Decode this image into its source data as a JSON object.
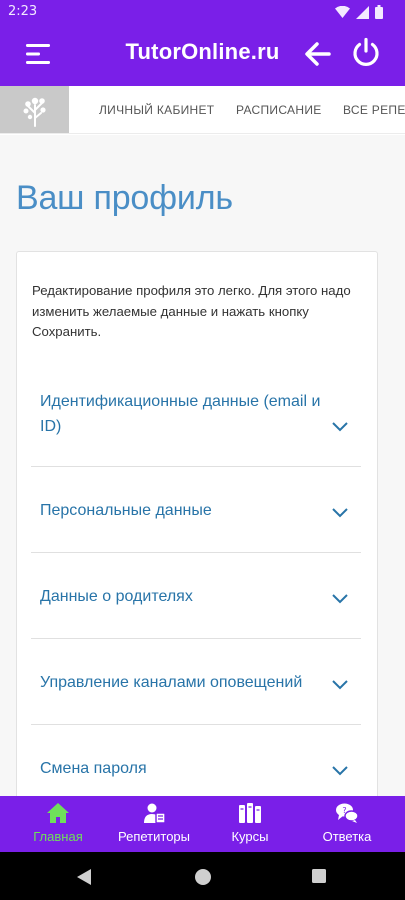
{
  "status_bar": {
    "time": "2:23",
    "icons": [
      "wifi-icon",
      "signal-icon",
      "battery-icon"
    ]
  },
  "app_bar": {
    "title": "TutorOnline.ru",
    "icons": [
      "menu-icon",
      "arrow-left-icon",
      "power-icon"
    ]
  },
  "top_nav": {
    "logo_icon": "tree-logo-icon",
    "links": [
      "ЛИЧНЫЙ КАБИНЕТ",
      "РАСПИСАНИЕ",
      "ВСЕ РЕПЕТ"
    ]
  },
  "page": {
    "title": "Ваш профиль",
    "intro": "Редактирование профиля это легко. Для этого надо изменить желаемые данные и нажать кнопку Сохранить."
  },
  "sections": [
    "Идентификационные данные (email и ID)",
    "Персональные данные",
    "Данные о родителях",
    "Управление каналами оповещений",
    "Смена пароля"
  ],
  "bottom_nav": {
    "active": "Главная",
    "items": [
      {
        "label": "Главная",
        "icon": "home-icon"
      },
      {
        "label": "Репетиторы",
        "icon": "tutor-icon"
      },
      {
        "label": "Курсы",
        "icon": "books-icon"
      },
      {
        "label": "Ответка",
        "icon": "chat-icon"
      }
    ]
  },
  "system_nav": [
    "back-triangle-icon",
    "home-circle-icon",
    "recents-square-icon"
  ],
  "colors": {
    "brand_purple": "#7a1fe8",
    "heading_blue": "#4a8ec6",
    "link_blue": "#2874a8",
    "active_green": "#6fe05a"
  }
}
